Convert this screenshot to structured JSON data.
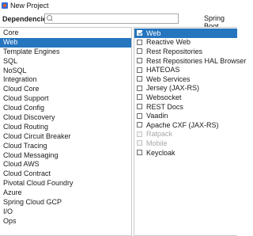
{
  "window": {
    "title": "New Project"
  },
  "toolbar": {
    "dependencies_label": "Dependencies",
    "search_value": "",
    "search_placeholder": "",
    "spring_boot_label": "Spring Boot"
  },
  "colors": {
    "selection": "#2675bf",
    "border": "#c8c8c8",
    "disabled_text": "#a8a8a8"
  },
  "categories": [
    {
      "label": "Core",
      "selected": false
    },
    {
      "label": "Web",
      "selected": true
    },
    {
      "label": "Template Engines",
      "selected": false
    },
    {
      "label": "SQL",
      "selected": false
    },
    {
      "label": "NoSQL",
      "selected": false
    },
    {
      "label": "Integration",
      "selected": false
    },
    {
      "label": "Cloud Core",
      "selected": false
    },
    {
      "label": "Cloud Support",
      "selected": false
    },
    {
      "label": "Cloud Config",
      "selected": false
    },
    {
      "label": "Cloud Discovery",
      "selected": false
    },
    {
      "label": "Cloud Routing",
      "selected": false
    },
    {
      "label": "Cloud Circuit Breaker",
      "selected": false
    },
    {
      "label": "Cloud Tracing",
      "selected": false
    },
    {
      "label": "Cloud Messaging",
      "selected": false
    },
    {
      "label": "Cloud AWS",
      "selected": false
    },
    {
      "label": "Cloud Contract",
      "selected": false
    },
    {
      "label": "Pivotal Cloud Foundry",
      "selected": false
    },
    {
      "label": "Azure",
      "selected": false
    },
    {
      "label": "Spring Cloud GCP",
      "selected": false
    },
    {
      "label": "I/O",
      "selected": false
    },
    {
      "label": "Ops",
      "selected": false
    }
  ],
  "dependencies": [
    {
      "label": "Web",
      "checked": true,
      "selected": true,
      "disabled": false
    },
    {
      "label": "Reactive Web",
      "checked": false,
      "selected": false,
      "disabled": false
    },
    {
      "label": "Rest Repositories",
      "checked": false,
      "selected": false,
      "disabled": false
    },
    {
      "label": "Rest Repositories HAL Browser",
      "checked": false,
      "selected": false,
      "disabled": false
    },
    {
      "label": "HATEOAS",
      "checked": false,
      "selected": false,
      "disabled": false
    },
    {
      "label": "Web Services",
      "checked": false,
      "selected": false,
      "disabled": false
    },
    {
      "label": "Jersey (JAX-RS)",
      "checked": false,
      "selected": false,
      "disabled": false
    },
    {
      "label": "Websocket",
      "checked": false,
      "selected": false,
      "disabled": false
    },
    {
      "label": "REST Docs",
      "checked": false,
      "selected": false,
      "disabled": false
    },
    {
      "label": "Vaadin",
      "checked": false,
      "selected": false,
      "disabled": false
    },
    {
      "label": "Apache CXF (JAX-RS)",
      "checked": false,
      "selected": false,
      "disabled": false
    },
    {
      "label": "Ratpack",
      "checked": false,
      "selected": false,
      "disabled": true
    },
    {
      "label": "Mobile",
      "checked": false,
      "selected": false,
      "disabled": true
    },
    {
      "label": "Keycloak",
      "checked": false,
      "selected": false,
      "disabled": false
    }
  ]
}
